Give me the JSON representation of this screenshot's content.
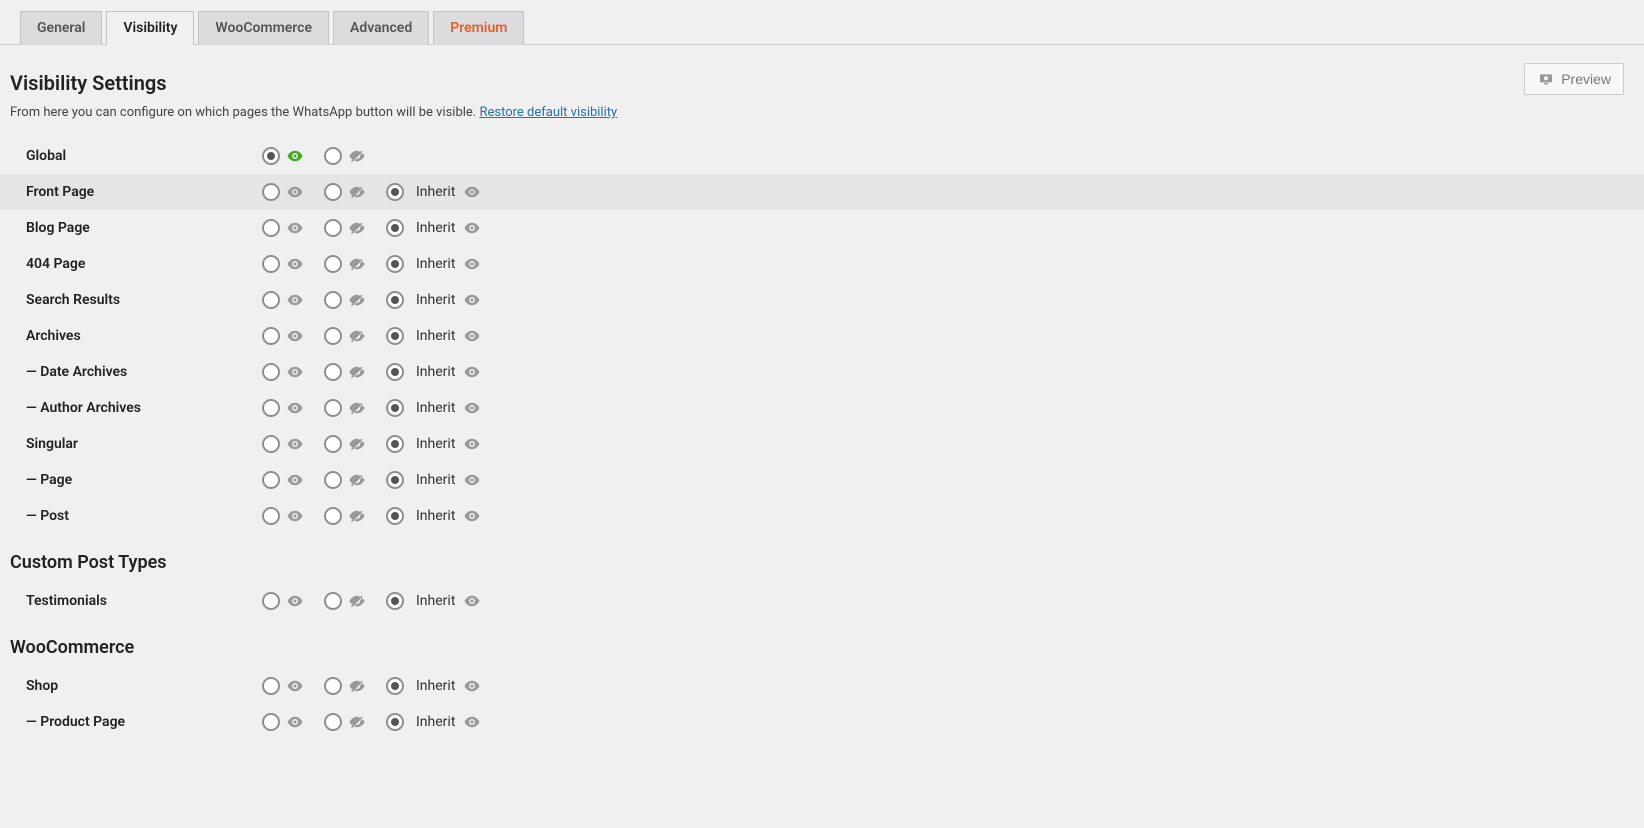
{
  "tabs": {
    "general": "General",
    "visibility": "Visibility",
    "woocommerce": "WooCommerce",
    "advanced": "Advanced",
    "premium": "Premium"
  },
  "preview_label": "Preview",
  "page_title": "Visibility Settings",
  "description_text": "From here you can configure on which pages the WhatsApp button will be visible. ",
  "restore_link": "Restore default visibility",
  "inherit_label": "Inherit",
  "section_custom_post_types": "Custom Post Types",
  "section_woocommerce": "WooCommerce",
  "rows": {
    "global": "Global",
    "front_page": "Front Page",
    "blog_page": "Blog Page",
    "page_404": "404 Page",
    "search_results": "Search Results",
    "archives": "Archives",
    "date_archives": "Date Archives",
    "author_archives": "Author Archives",
    "singular": "Singular",
    "page": "Page",
    "post": "Post",
    "testimonials": "Testimonials",
    "shop": "Shop",
    "product_page": "Product Page"
  }
}
